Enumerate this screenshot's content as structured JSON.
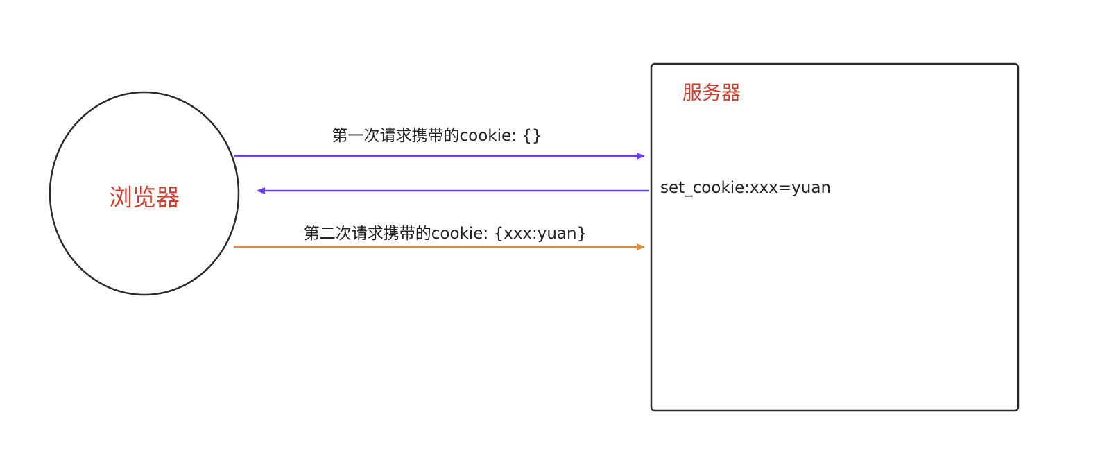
{
  "nodes": {
    "browser": {
      "label": "浏览器"
    },
    "server": {
      "label": "服务器"
    }
  },
  "edges": {
    "first_request": {
      "label": "第一次请求携带的cookie:   {}"
    },
    "response": {
      "label": "set_cookie:xxx=yuan"
    },
    "second_request": {
      "label": "第二次请求携带的cookie:   {xxx:yuan}"
    }
  },
  "colors": {
    "title_text": "#c8412f",
    "arrow_request_response": "#6a3df2",
    "arrow_second_request": "#e08a3a",
    "outline": "#2a2a2a"
  }
}
